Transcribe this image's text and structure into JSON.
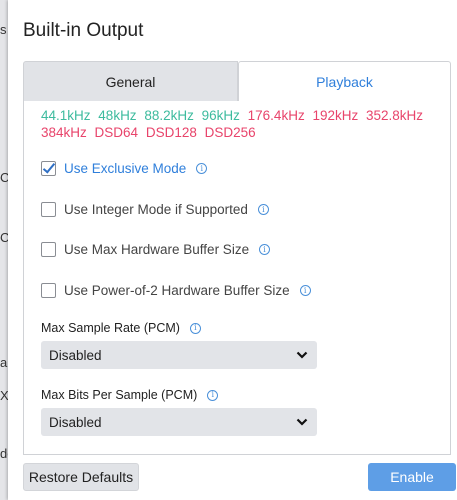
{
  "background": {
    "left_fragments": [
      "s",
      "C",
      "C",
      "a",
      "XI",
      "de"
    ]
  },
  "dialog": {
    "title": "Built-in Output",
    "tabs": [
      {
        "label": "General",
        "active": false
      },
      {
        "label": "Playback",
        "active": true
      }
    ],
    "sample_rates": [
      {
        "label": "44.1kHz",
        "color": "#3dbb9e"
      },
      {
        "label": "48kHz",
        "color": "#3dbb9e"
      },
      {
        "label": "88.2kHz",
        "color": "#3dbb9e"
      },
      {
        "label": "96kHz",
        "color": "#3dbb9e"
      },
      {
        "label": "176.4kHz",
        "color": "#e8446b"
      },
      {
        "label": "192kHz",
        "color": "#e8446b"
      },
      {
        "label": "352.8kHz",
        "color": "#e8446b"
      },
      {
        "label": "384kHz",
        "color": "#e8446b"
      },
      {
        "label": "DSD64",
        "color": "#e8446b"
      },
      {
        "label": "DSD128",
        "color": "#e8446b"
      },
      {
        "label": "DSD256",
        "color": "#e8446b"
      }
    ],
    "options": [
      {
        "label": "Use Exclusive Mode",
        "checked": true
      },
      {
        "label": "Use Integer Mode if Supported",
        "checked": false
      },
      {
        "label": "Use Max Hardware Buffer Size",
        "checked": false
      },
      {
        "label": "Use Power-of-2 Hardware Buffer Size",
        "checked": false
      }
    ],
    "max_sample_rate": {
      "label": "Max Sample Rate (PCM)",
      "value": "Disabled"
    },
    "max_bits": {
      "label": "Max Bits Per Sample (PCM)",
      "value": "Disabled"
    },
    "buttons": {
      "restore": "Restore Defaults",
      "enable": "Enable"
    },
    "info_glyph": "i",
    "icons": [
      "info-icon",
      "chevron-down-icon",
      "checkmark-icon"
    ],
    "accent_color": "#2f7fdb"
  }
}
